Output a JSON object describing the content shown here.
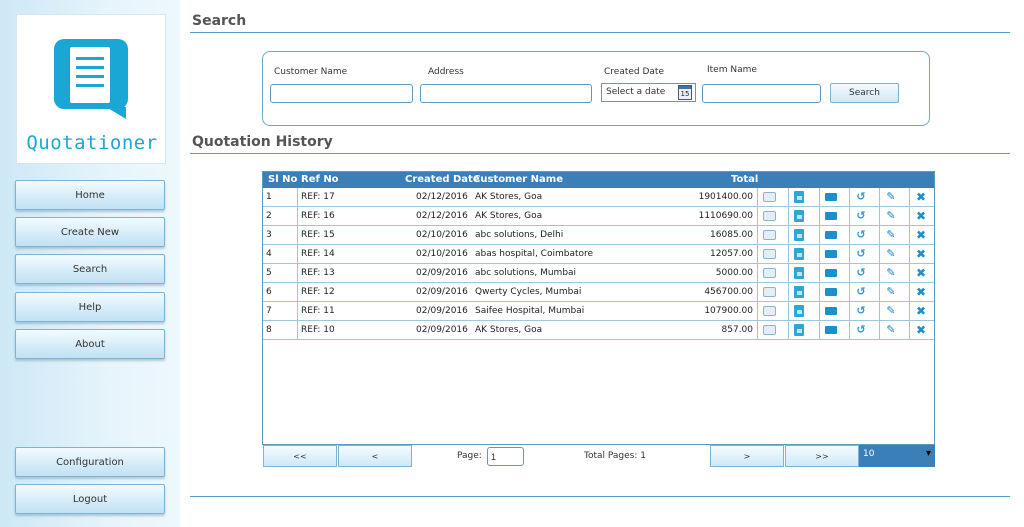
{
  "app": {
    "logo_text": "Quotationer"
  },
  "sidebar": {
    "items": [
      {
        "label": "Home"
      },
      {
        "label": "Create New"
      },
      {
        "label": "Search"
      },
      {
        "label": "Help"
      },
      {
        "label": "About"
      }
    ],
    "bottom_items": [
      {
        "label": "Configuration"
      },
      {
        "label": "Logout"
      }
    ]
  },
  "search": {
    "title": "Search",
    "customer_name_label": "Customer Name",
    "address_label": "Address",
    "created_date_label": "Created Date",
    "item_name_label": "Item Name",
    "date_placeholder": "Select a date",
    "calendar_day": "15",
    "search_button": "Search",
    "customer_name_value": "",
    "address_value": "",
    "item_name_value": ""
  },
  "history": {
    "title": "Quotation History",
    "columns": {
      "sl_no": "Sl No",
      "ref_no": "Ref No",
      "created_date": "Created Date",
      "customer_name": "Customer Name",
      "total": "Total"
    },
    "rows": [
      {
        "sl": "1",
        "ref": "REF: 17",
        "date": "02/12/2016",
        "customer": "AK Stores, Goa",
        "total": "1901400.00"
      },
      {
        "sl": "2",
        "ref": "REF: 16",
        "date": "02/12/2016",
        "customer": "AK Stores, Goa",
        "total": "1110690.00"
      },
      {
        "sl": "3",
        "ref": "REF: 15",
        "date": "02/10/2016",
        "customer": "abc solutions, Delhi",
        "total": "16085.00"
      },
      {
        "sl": "4",
        "ref": "REF: 14",
        "date": "02/10/2016",
        "customer": "abas hospital, Coimbatore",
        "total": "12057.00"
      },
      {
        "sl": "5",
        "ref": "REF: 13",
        "date": "02/09/2016",
        "customer": "abc solutions, Mumbai",
        "total": "5000.00"
      },
      {
        "sl": "6",
        "ref": "REF: 12",
        "date": "02/09/2016",
        "customer": "Qwerty Cycles, Mumbai",
        "total": "456700.00"
      },
      {
        "sl": "7",
        "ref": "REF: 11",
        "date": "02/09/2016",
        "customer": "Saifee Hospital, Mumbai",
        "total": "107900.00"
      },
      {
        "sl": "8",
        "ref": "REF: 10",
        "date": "02/09/2016",
        "customer": "AK Stores, Goa",
        "total": "857.00"
      }
    ],
    "row_actions": [
      "mail-icon",
      "pdf-icon",
      "folder-icon",
      "undo-icon",
      "edit-icon",
      "delete-icon"
    ]
  },
  "pager": {
    "first": "<<",
    "prev": "<",
    "page_label": "Page:",
    "page_value": "1",
    "total_pages": "Total Pages: 1",
    "next": ">",
    "last": ">>",
    "page_size": "10"
  },
  "colors": {
    "accent": "#3a7fb8",
    "logo": "#1aa7d6"
  }
}
